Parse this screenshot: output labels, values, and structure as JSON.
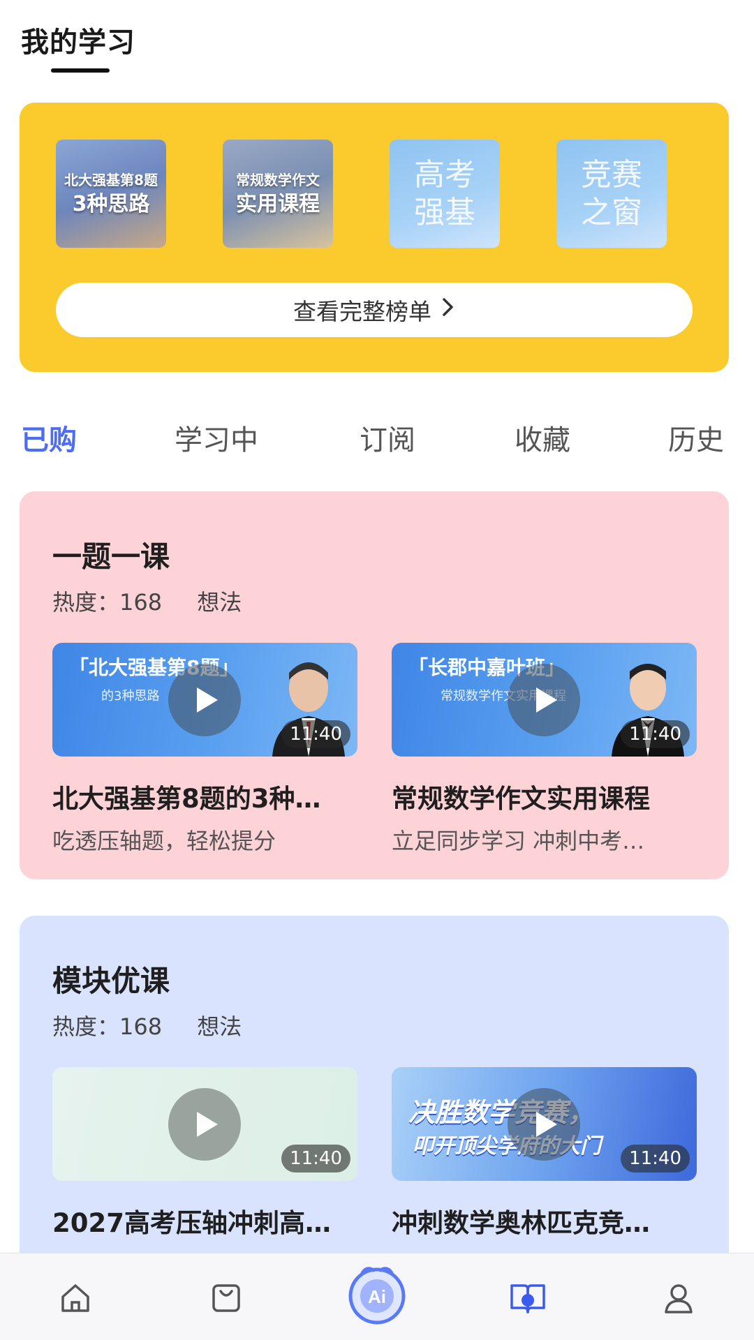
{
  "header": {
    "title": "我的学习"
  },
  "ranking": {
    "cards": [
      {
        "line1": "北大强基第8题",
        "line2": "3种思路"
      },
      {
        "line1": "常规数学作文",
        "line2": "实用课程"
      },
      {
        "line1": "高考",
        "line2": "强基"
      },
      {
        "line1": "竞赛",
        "line2": "之窗"
      }
    ],
    "button_label": "查看完整榜单",
    "button_chevron": "〉",
    "bg_color": "#fbca2c"
  },
  "tabs": [
    {
      "label": "已购",
      "active": true
    },
    {
      "label": "学习中",
      "active": false
    },
    {
      "label": "订阅",
      "active": false
    },
    {
      "label": "收藏",
      "active": false
    },
    {
      "label": "历史",
      "active": false
    }
  ],
  "sections": [
    {
      "title": "一题一课",
      "heat": "热度：168",
      "ideas": "想法",
      "bg_color": "#fdd3d8",
      "courses": [
        {
          "thumb_text": "「北大强基第8题」",
          "thumb_sub": "的3种思路",
          "duration": "11:40",
          "title": "北大强基第8题的3种…",
          "subtitle": "吃透压轴题，轻松提分"
        },
        {
          "thumb_text": "「长郡中嘉叶班」",
          "thumb_sub": "常规数学作文实用课程",
          "duration": "11:40",
          "title": "常规数学作文实用课程",
          "subtitle": "立足同步学习 冲刺中考…"
        }
      ]
    },
    {
      "title": "模块优课",
      "heat": "热度：168",
      "ideas": "想法",
      "bg_color": "#dae3fe",
      "courses": [
        {
          "duration": "11:40",
          "title": "2027高考压轴冲刺高…",
          "subtitle": ""
        },
        {
          "promo_line1": "决胜数学竞赛，",
          "promo_line2": "叩开顶尖学府的大门",
          "duration": "11:40",
          "title": "冲刺数学奥林匹克竞…",
          "subtitle": ""
        }
      ]
    }
  ],
  "bottom_nav": [
    {
      "icon": "home-icon",
      "label": ""
    },
    {
      "icon": "bag-icon",
      "label": ""
    },
    {
      "icon": "ai-icon",
      "label": ""
    },
    {
      "icon": "book-icon",
      "label": "",
      "active": true
    },
    {
      "icon": "person-icon",
      "label": ""
    }
  ],
  "colors": {
    "accent": "#4d6df5"
  }
}
